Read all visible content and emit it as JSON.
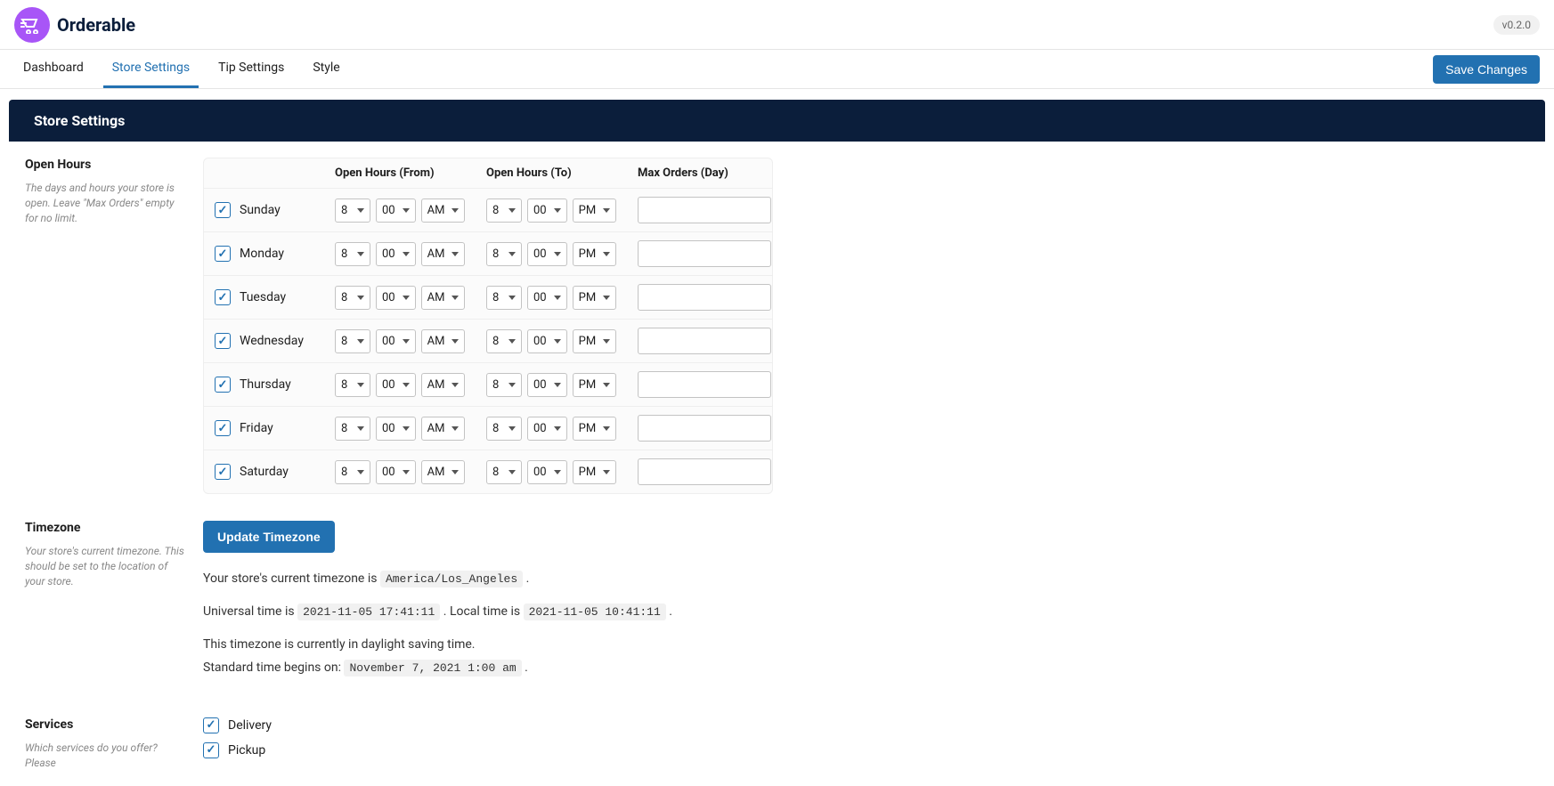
{
  "header": {
    "brand": "Orderable",
    "version": "v0.2.0"
  },
  "tabs": {
    "items": [
      {
        "label": "Dashboard",
        "active": false
      },
      {
        "label": "Store Settings",
        "active": true
      },
      {
        "label": "Tip Settings",
        "active": false
      },
      {
        "label": "Style",
        "active": false
      }
    ],
    "save_label": "Save Changes"
  },
  "page_title": "Store Settings",
  "open_hours": {
    "title": "Open Hours",
    "desc": "The days and hours your store is open. Leave \"Max Orders\" empty for no limit.",
    "headers": {
      "from": "Open Hours (From)",
      "to": "Open Hours (To)",
      "max": "Max Orders (Day)"
    },
    "days": [
      {
        "name": "Sunday",
        "enabled": true,
        "from_h": "8",
        "from_m": "00",
        "from_p": "AM",
        "to_h": "8",
        "to_m": "00",
        "to_p": "PM",
        "max": ""
      },
      {
        "name": "Monday",
        "enabled": true,
        "from_h": "8",
        "from_m": "00",
        "from_p": "AM",
        "to_h": "8",
        "to_m": "00",
        "to_p": "PM",
        "max": ""
      },
      {
        "name": "Tuesday",
        "enabled": true,
        "from_h": "8",
        "from_m": "00",
        "from_p": "AM",
        "to_h": "8",
        "to_m": "00",
        "to_p": "PM",
        "max": ""
      },
      {
        "name": "Wednesday",
        "enabled": true,
        "from_h": "8",
        "from_m": "00",
        "from_p": "AM",
        "to_h": "8",
        "to_m": "00",
        "to_p": "PM",
        "max": ""
      },
      {
        "name": "Thursday",
        "enabled": true,
        "from_h": "8",
        "from_m": "00",
        "from_p": "AM",
        "to_h": "8",
        "to_m": "00",
        "to_p": "PM",
        "max": ""
      },
      {
        "name": "Friday",
        "enabled": true,
        "from_h": "8",
        "from_m": "00",
        "from_p": "AM",
        "to_h": "8",
        "to_m": "00",
        "to_p": "PM",
        "max": ""
      },
      {
        "name": "Saturday",
        "enabled": true,
        "from_h": "8",
        "from_m": "00",
        "from_p": "AM",
        "to_h": "8",
        "to_m": "00",
        "to_p": "PM",
        "max": ""
      }
    ]
  },
  "timezone": {
    "title": "Timezone",
    "desc": "Your store's current timezone. This should be set to the location of your store.",
    "button": "Update Timezone",
    "current_prefix": "Your store's current timezone is ",
    "current_value": "America/Los_Angeles",
    "utc_prefix": "Universal time is ",
    "utc_value": "2021-11-05 17:41:11",
    "local_prefix": ". Local time is ",
    "local_value": "2021-11-05 10:41:11",
    "dst_line": "This timezone is currently in daylight saving time.",
    "std_prefix": "Standard time begins on: ",
    "std_value": "November 7, 2021 1:00 am"
  },
  "services": {
    "title": "Services",
    "desc": "Which services do you offer? Please",
    "items": [
      {
        "label": "Delivery",
        "checked": true
      },
      {
        "label": "Pickup",
        "checked": true
      }
    ]
  }
}
